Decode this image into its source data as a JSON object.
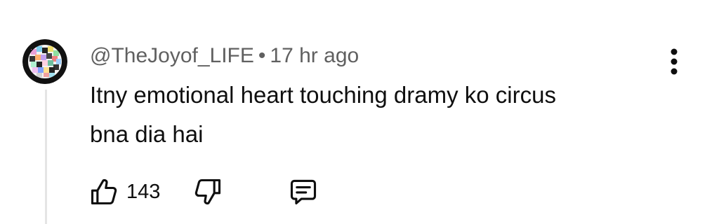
{
  "comment": {
    "author": "@TheJoyof_LIFE",
    "separator": "•",
    "time": "17 hr ago",
    "text": "Itny emotional heart touching dramy ko circus\nbna dia hai",
    "likes": "143"
  },
  "icons": {
    "like": "thumbs-up-icon",
    "dislike": "thumbs-down-icon",
    "reply": "reply-comment-icon",
    "menu": "more-vert-icon"
  },
  "colors": {
    "text": "#0f0f0f",
    "meta": "#606060",
    "thread_line": "#e5e5e5"
  }
}
